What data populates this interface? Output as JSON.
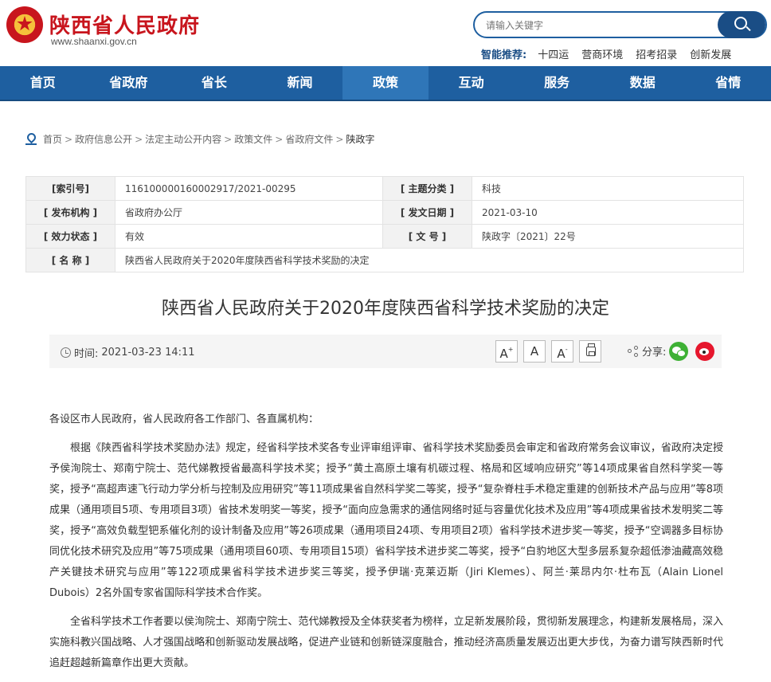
{
  "header": {
    "site_name": "陕西省人民政府",
    "url": "www.shaanxi.gov.cn",
    "search_placeholder": "请输入关键字",
    "hot_label": "智能推荐:",
    "hot_items": [
      "十四运",
      "营商环境",
      "招考招录",
      "创新发展"
    ]
  },
  "nav": {
    "items": [
      "首页",
      "省政府",
      "省长",
      "新闻",
      "政策",
      "互动",
      "服务",
      "数据",
      "省情"
    ],
    "active_index": 4
  },
  "breadcrumb": [
    "首页",
    "政府信息公开",
    "法定主动公开内容",
    "政策文件",
    "省政府文件",
    "陕政字"
  ],
  "info": {
    "index_no_label": "[索引号]",
    "index_no": "116100000160002917/2021-00295",
    "category_label": "[ 主题分类 ]",
    "category": "科技",
    "issuer_label": "[ 发布机构 ]",
    "issuer": "省政府办公厅",
    "date_label": "[ 发文日期 ]",
    "date": "2021-03-10",
    "status_label": "[ 效力状态 ]",
    "status": "有效",
    "doc_no_label": "[ 文 号 ]",
    "doc_no": "陕政字〔2021〕22号",
    "name_label": "[ 名 称 ]",
    "name": "陕西省人民政府关于2020年度陕西省科学技术奖励的决定"
  },
  "article": {
    "title": "陕西省人民政府关于2020年度陕西省科学技术奖励的决定",
    "time_label": "时间:",
    "time": "2021-03-23 14:11",
    "font_large": "A",
    "font_medium": "A",
    "font_small": "A",
    "share_label": "分享:",
    "salutation": "各设区市人民政府，省人民政府各工作部门、各直属机构：",
    "paragraph1": "根据《陕西省科学技术奖励办法》规定，经省科学技术奖各专业评审组评审、省科学技术奖励委员会审定和省政府常务会议审议，省政府决定授予侯洵院士、郑南宁院士、范代娣教授省最高科学技术奖；授予“黄土高原土壤有机碳过程、格局和区域响应研究”等14项成果省自然科学奖一等奖，授予“高超声速飞行动力学分析与控制及应用研究”等11项成果省自然科学奖二等奖，授予“复杂脊柱手术稳定重建的创新技术产品与应用”等8项成果（通用项目5项、专用项目3项）省技术发明奖一等奖，授予“面向应急需求的通信网络时延与容量优化技术及应用”等4项成果省技术发明奖二等奖，授予“高效负载型钯系催化剂的设计制备及应用”等26项成果（通用项目24项、专用项目2项）省科学技术进步奖一等奖，授予“空调器多目标协同优化技术研究及应用”等75项成果（通用项目60项、专用项目15项）省科学技术进步奖二等奖，授予“白豹地区大型多层系复杂超低渗油藏高效稳产关键技术研究与应用”等122项成果省科学技术进步奖三等奖，授予伊瑞·克莱迈斯（Jiri Klemes）、阿兰·莱昂内尔·杜布瓦（Alain Lionel Dubois）2名外国专家省国际科学技术合作奖。",
    "paragraph2": "全省科学技术工作者要以侯洵院士、郑南宁院士、范代娣教授及全体获奖者为榜样，立足新发展阶段，贯彻新发展理念，构建新发展格局，深入实施科教兴国战略、人才强国战略和创新驱动发展战略，促进产业链和创新链深度融合，推动经济高质量发展迈出更大步伐，为奋力谱写陕西新时代追赶超越新篇章作出更大贡献。"
  }
}
